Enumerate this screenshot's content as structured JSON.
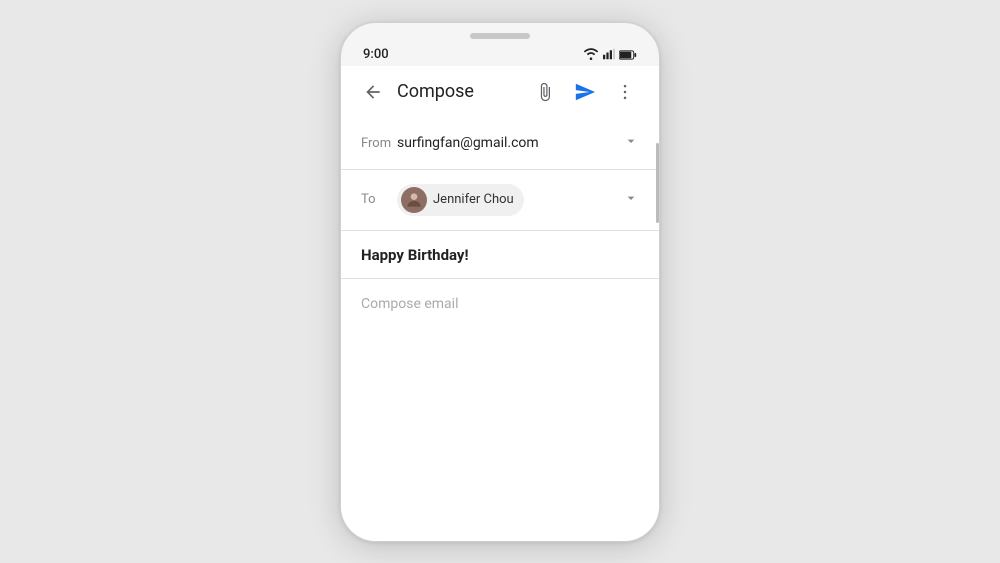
{
  "status_bar": {
    "time": "9:00",
    "wifi_label": "wifi",
    "signal_label": "signal",
    "battery_label": "battery"
  },
  "app_bar": {
    "title": "Compose",
    "back_label": "back",
    "attach_label": "attach",
    "send_label": "send",
    "more_label": "more options"
  },
  "compose": {
    "from_label": "From",
    "from_value": "surfingfan@gmail.com",
    "to_label": "To",
    "recipient_name": "Jennifer Chou",
    "subject": "Happy Birthday!",
    "body_placeholder": "Compose email"
  },
  "colors": {
    "send_icon": "#1a73e8",
    "attach_icon": "#5f6368",
    "more_icon": "#5f6368",
    "back_icon": "#5f6368"
  }
}
